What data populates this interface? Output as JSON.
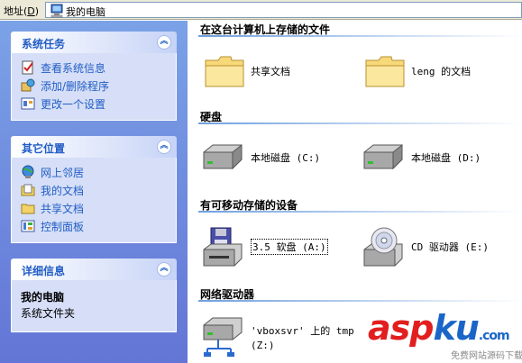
{
  "address": {
    "label": "地址",
    "label_key": "D",
    "value": "我的电脑"
  },
  "sidebar": {
    "system_tasks": {
      "title": "系统任务",
      "items": [
        {
          "label": "查看系统信息",
          "icon": "system-info-icon"
        },
        {
          "label": "添加/删除程序",
          "icon": "add-remove-programs-icon"
        },
        {
          "label": "更改一个设置",
          "icon": "control-panel-settings-icon"
        }
      ]
    },
    "other_places": {
      "title": "其它位置",
      "items": [
        {
          "label": "网上邻居",
          "icon": "network-places-icon"
        },
        {
          "label": "我的文档",
          "icon": "my-documents-icon"
        },
        {
          "label": "共享文档",
          "icon": "shared-folder-icon"
        },
        {
          "label": "控制面板",
          "icon": "control-panel-icon"
        }
      ]
    },
    "details": {
      "title": "详细信息",
      "name": "我的电脑",
      "subtitle": "系统文件夹"
    }
  },
  "content": {
    "groups": [
      {
        "title": "在这台计算机上存储的文件",
        "items": [
          {
            "label": "共享文档",
            "icon": "folder-icon"
          },
          {
            "label": "leng 的文档",
            "icon": "folder-icon"
          }
        ]
      },
      {
        "title": "硬盘",
        "items": [
          {
            "label": "本地磁盘 (C:)",
            "icon": "hard-drive-icon"
          },
          {
            "label": "本地磁盘 (D:)",
            "icon": "hard-drive-icon"
          }
        ]
      },
      {
        "title": "有可移动存储的设备",
        "items": [
          {
            "label": "3.5 软盘 (A:)",
            "icon": "floppy-drive-icon"
          },
          {
            "label": "CD 驱动器 (E:)",
            "icon": "cd-drive-icon"
          }
        ]
      },
      {
        "title": "网络驱动器",
        "items": [
          {
            "label": "'vboxsvr' 上的 tmp",
            "label2": "(Z:)",
            "icon": "network-drive-icon"
          }
        ]
      }
    ]
  },
  "watermark": {
    "text_red": "asp",
    "text_blue": "ku",
    "suffix": ".com",
    "sub": "免费网站源码下载站!"
  },
  "colors": {
    "pane_top": "#7ba2e7",
    "pane_bottom": "#6375d6",
    "link": "#215dc6",
    "box_body": "#d6dff7"
  }
}
